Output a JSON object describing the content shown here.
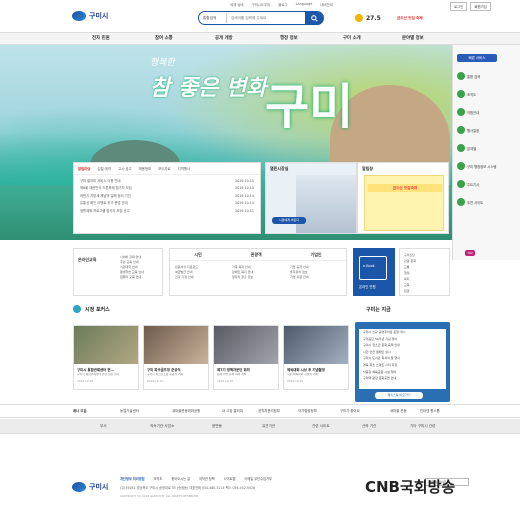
{
  "header": {
    "site_name": "구미시",
    "util_links": [
      "세계 상태",
      "구미시도우미",
      "블로그",
      "Language",
      "내비안내"
    ],
    "search_select": "통합검색",
    "search_placeholder": "검색어를 입력해 주세요",
    "weather_temp": "27.5",
    "promo": "금오산 맛집 축제",
    "user_buttons": [
      "로그인",
      "회원가입"
    ]
  },
  "nav": {
    "items": [
      "전자 민원",
      "참여 소통",
      "공개 개방",
      "행정 정보",
      "구미 소개",
      "분야별 정보"
    ]
  },
  "hero": {
    "title": "참 좋은 변화",
    "subtitle": "행복한",
    "big": "구미"
  },
  "news": {
    "tabs": [
      "알림마당",
      "입찰·계약",
      "고시·공고",
      "채용정보",
      "보도자료",
      "지역행사"
    ],
    "rows": [
      {
        "text": "구미 알리미 서비스 이용 안내",
        "date": "2019.10.15"
      },
      {
        "text": "제6회 대한민국 드론축제 참가자 모집",
        "date": "2019.10.15"
      },
      {
        "text": "하반기 지방세 체납액 일제 정리 기간",
        "date": "2019.10.14"
      },
      {
        "text": "유통성 확인 이벤트 추가 운영 안내",
        "date": "2019.10.14"
      },
      {
        "text": "생활체육 프로그램 참가자 모집 공고",
        "date": "2019.10.11"
      }
    ]
  },
  "mayor": {
    "title": "열린시장실",
    "button": "시장에게 바란다"
  },
  "popup": {
    "title": "알림창",
    "banner": "금오산 맛집축제"
  },
  "sidebar": {
    "head": "빠른 서비스",
    "items": [
      "통합 검색",
      "조직도",
      "직원안내",
      "행사일정",
      "분야별",
      "구미 행정정보 시스템",
      "주요기사",
      "추천 사이트"
    ],
    "top": "TOP"
  },
  "quick": {
    "online_label": "온라인교육",
    "online_list": [
      "사이버 강좌 안내",
      "주민 교육 안내",
      "시민대학 안내",
      "평생학습 교육 안내",
      "컴퓨터 교육 안내"
    ],
    "tabs": [
      "시민",
      "관광객",
      "기업인"
    ],
    "col1": [
      "민원서식 다운로드",
      "여권발급 안내",
      "건강 가정 안내"
    ],
    "col2": [
      "가족 복지 안내",
      "장애인 복지 안내",
      "일자리 창출 정보"
    ],
    "col3": [
      "기업 공개 안내",
      "투자유치 정보",
      "기업 지원 안내"
    ],
    "right_list": [
      "구미산단",
      "관광 문화",
      "교통",
      "행정",
      "복지",
      "교육",
      "환경"
    ],
    "ebook": "e-Book",
    "ebook_label": "온라인 민원"
  },
  "focus": {
    "title": "시정 포커스",
    "cards": [
      {
        "title": "구미시 통합관제센터 현...",
        "desc": "구미시 통합관제센터 현장 점검 실시",
        "date": "2019.10.15"
      },
      {
        "title": "구미 파크골프장 준공식",
        "desc": "구미시 파크골프장 준공식 개최",
        "date": "2019.10.15"
      },
      {
        "title": "제7기 정책자문단 회의",
        "desc": "정책 현안 논의 회의 개최",
        "date": "2019.10.15"
      },
      {
        "title": "체육대회 시상 후 기념촬영",
        "desc": "시민 체육대회 시상식 개최",
        "date": "2019.10.15"
      }
    ]
  },
  "gumi_now": {
    "title": "구미는 지금",
    "rows": [
      "구미시 신규 공영주차장 운영 개시",
      "구미공단 50주년 기념 행사",
      "구미시 청소년 문화 축제 안내",
      "시민 안전 캠페인 실시",
      "구미시 도서관 독서의 달 행사",
      "경북 최초 스마트 시티 지정",
      "낙동강 체육공원 시설 정비",
      "구미역 광장 문화공연 안내"
    ],
    "button": "페이스북 바로가기"
  },
  "banner": {
    "items": [
      "배너 모음",
      "농업기술센터",
      "새마을운동테마공원",
      "내 고장 알리미",
      "공직자윤리정보",
      "국가법령정보",
      "구미가 좋아요",
      "새마을 운동",
      "인터넷 원스톱"
    ]
  },
  "footer_nav": {
    "items": [
      "부서",
      "직속기관·사업소",
      "읍면동",
      "유관기관",
      "관련 사이트",
      "산하 기관",
      "기타 구미시 관련"
    ]
  },
  "footer": {
    "logo_name": "구미시",
    "links": [
      "개인정보 처리방침",
      "조직도",
      "찾아오시는 길",
      "저작권 정책",
      "사이트맵",
      "이메일 무단수집거부"
    ],
    "address": "(우)39281 경상북도 구미시 송정대로 55 (송정동)  대표전화 054-480-5114  팩스 054-452-5026",
    "copyright": "COPYRIGHT (C) 2018 GUMI CITY. ALL RIGHTS RESERVED.",
    "family_site": "패밀리 사이트",
    "watermark": "CNB국회방송"
  }
}
